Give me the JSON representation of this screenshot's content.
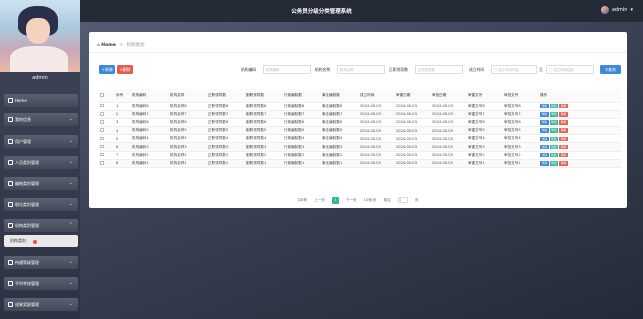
{
  "header": {
    "title": "公务员分级分类管理系统",
    "menu_icon": "≡",
    "user_name": "admin",
    "user_caret": "▾"
  },
  "sidebar": {
    "user_name": "admin",
    "items": [
      {
        "label": "Home",
        "icon": "home-icon",
        "expanded": false
      },
      {
        "label": "我的信息",
        "icon": "user-card-icon",
        "expanded": false
      },
      {
        "label": "用户管理",
        "icon": "mail-icon",
        "expanded": false
      },
      {
        "label": "人员类别管理",
        "icon": "grid-icon",
        "expanded": false
      },
      {
        "label": "编制类别管理",
        "icon": "grid-icon",
        "expanded": false
      },
      {
        "label": "职位类别管理",
        "icon": "grid-icon",
        "expanded": false
      },
      {
        "label": "机构类别管理",
        "icon": "grid-icon",
        "expanded": true
      },
      {
        "label": "待遇等级管理",
        "icon": "grid-icon",
        "expanded": false
      },
      {
        "label": "平时考核管理",
        "icon": "grid-icon",
        "expanded": false
      },
      {
        "label": "成果奖励管理",
        "icon": "grid-icon",
        "expanded": false
      }
    ],
    "sub_item": "机构类别",
    "chevron": "⌄"
  },
  "breadcrumb": {
    "home": "Home",
    "sep": ">",
    "current": "机构类别"
  },
  "toolbar": {
    "add": "新增",
    "delete": "删除",
    "search": "查询",
    "filters": [
      {
        "label": "机构编码",
        "placeholder": "机构编码"
      },
      {
        "label": "机构名称",
        "placeholder": "机构名称"
      },
      {
        "label": "正职领导数",
        "placeholder": "正职领导数"
      },
      {
        "label": "成立时间",
        "placeholder": "成立时间开始"
      },
      {
        "label": "",
        "placeholder": "成立时间结束"
      }
    ],
    "range_sep": "至"
  },
  "table": {
    "columns": [
      "",
      "序号",
      "机构编码",
      "机构名称",
      "正职领导数",
      "副职领导数",
      "行政编制数",
      "事业编制数",
      "成立时间",
      "审建日期",
      "审批日期",
      "审建文号",
      "审批文号",
      "操作"
    ],
    "rows": [
      [
        "1",
        "机构编码8",
        "机构名称8",
        "正职领导数8",
        "副职领导数8",
        "行政编制数8",
        "事业编制数8",
        "2024-05-03",
        "2024-05-03",
        "2024-05-03",
        "审建文号8",
        "审批文号8"
      ],
      [
        "2",
        "机构编码7",
        "机构名称7",
        "正职领导数7",
        "副职领导数7",
        "行政编制数7",
        "事业编制数7",
        "2024-05-03",
        "2024-05-03",
        "2024-05-03",
        "审建文号7",
        "审批文号7"
      ],
      [
        "3",
        "机构编码6",
        "机构名称6",
        "正职领导数6",
        "副职领导数6",
        "行政编制数6",
        "事业编制数6",
        "2024-05-03",
        "2024-05-03",
        "2024-05-03",
        "审建文号6",
        "审批文号6"
      ],
      [
        "4",
        "机构编码5",
        "机构名称5",
        "正职领导数5",
        "副职领导数5",
        "行政编制数5",
        "事业编制数5",
        "2024-05-03",
        "2024-05-03",
        "2024-05-03",
        "审建文号5",
        "审批文号5"
      ],
      [
        "5",
        "机构编码4",
        "机构名称4",
        "正职领导数4",
        "副职领导数4",
        "行政编制数4",
        "事业编制数4",
        "2024-05-03",
        "2024-05-03",
        "2024-05-03",
        "审建文号4",
        "审批文号4"
      ],
      [
        "6",
        "机构编码3",
        "机构名称3",
        "正职领导数3",
        "副职领导数3",
        "行政编制数3",
        "事业编制数3",
        "2024-05-03",
        "2024-05-03",
        "2024-05-03",
        "审建文号3",
        "审批文号3"
      ],
      [
        "7",
        "机构编码2",
        "机构名称2",
        "正职领导数2",
        "副职领导数2",
        "行政编制数2",
        "事业编制数2",
        "2024-05-03",
        "2024-05-03",
        "2024-05-03",
        "审建文号2",
        "审批文号2"
      ],
      [
        "8",
        "机构编码1",
        "机构名称1",
        "正职领导数1",
        "副职领导数1",
        "行政编制数1",
        "事业编制数1",
        "2024-05-03",
        "2024-05-03",
        "2024-05-03",
        "审建文号1",
        "审批文号1"
      ]
    ],
    "row_actions": [
      "详情",
      "修改",
      "删除"
    ]
  },
  "pager": {
    "total": "共8条",
    "prev": "上一页",
    "current_page": "1",
    "next": "下一页",
    "page_size": "10条/页",
    "goto_prefix": "前往",
    "goto_value": "1",
    "goto_suffix": "页"
  },
  "colors": {
    "primary": "#3c8ad6",
    "danger": "#e65c4f",
    "success": "#36b59a",
    "topbar": "#242a36"
  }
}
